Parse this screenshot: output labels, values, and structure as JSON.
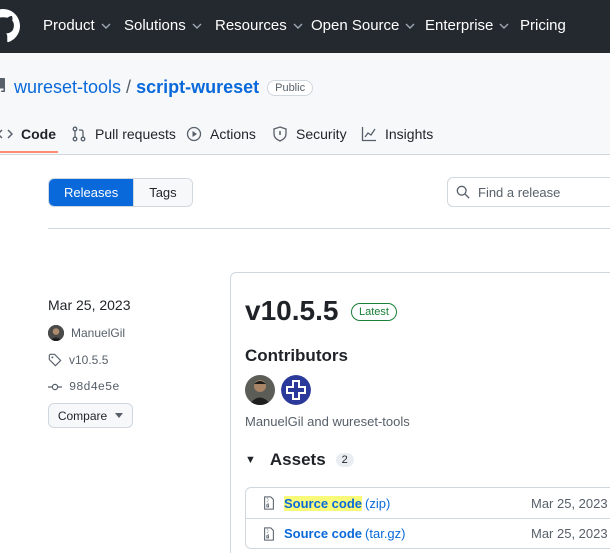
{
  "nav": {
    "items": [
      {
        "label": "Product"
      },
      {
        "label": "Solutions"
      },
      {
        "label": "Resources"
      },
      {
        "label": "Open Source"
      },
      {
        "label": "Enterprise"
      },
      {
        "label": "Pricing"
      }
    ]
  },
  "repo": {
    "owner": "wureset-tools",
    "separator": "/",
    "name": "script-wureset",
    "visibility": "Public"
  },
  "tabs": [
    {
      "label": "Code",
      "icon": "code-icon",
      "active": true
    },
    {
      "label": "Pull requests",
      "icon": "pull-request-icon"
    },
    {
      "label": "Actions",
      "icon": "play-icon"
    },
    {
      "label": "Security",
      "icon": "shield-icon"
    },
    {
      "label": "Insights",
      "icon": "graph-icon"
    }
  ],
  "toggle": {
    "releases": "Releases",
    "tags": "Tags"
  },
  "search": {
    "placeholder": "Find a release"
  },
  "release": {
    "date": "Mar 25, 2023",
    "author": "ManuelGil",
    "tag": "v10.5.5",
    "commit": "98d4e5e",
    "compare_label": "Compare",
    "version": "v10.5.5",
    "badge": "Latest",
    "contributors_title": "Contributors",
    "contributors_text": "ManuelGil and wureset-tools",
    "assets_title": "Assets",
    "assets_count": "2",
    "assets": [
      {
        "name": "Source code",
        "suffix": "(zip)",
        "date": "Mar 25, 2023"
      },
      {
        "name": "Source code",
        "suffix": "(tar.gz)",
        "date": "Mar 25, 2023"
      }
    ]
  },
  "colors": {
    "nav_bg": "#24292f",
    "link": "#0969da",
    "latest_green": "#1a7f37",
    "tab_underline": "#fd8c73",
    "highlight": "#fbfb7a"
  }
}
